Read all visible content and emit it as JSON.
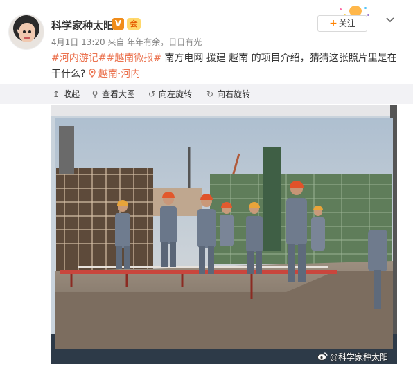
{
  "user": {
    "name": "科学家种太阳",
    "verified_badge": "V",
    "vip_badge": "会"
  },
  "post": {
    "meta": "4月1日 13:20 来自 年年有余，日日有光",
    "hashtag1": "#河内游记#",
    "hashtag2": "#越南微报#",
    "text": " 南方电网 援建 越南 的项目介绍，猜猜这张照片里是在干什么?",
    "location": "越南·河内"
  },
  "header": {
    "follow_label": "关注",
    "follow_plus": "+"
  },
  "toolbar": {
    "collapse": "收起",
    "view_large": "查看大图",
    "rotate_left": "向左旋转",
    "rotate_right": "向右旋转"
  },
  "photo": {
    "watermark": "@科学家种太阳"
  },
  "colors": {
    "accent": "#eb7350",
    "follow_plus": "#ff8200",
    "verified": "#f08c1a",
    "toolbar_bg": "#f2f2f5"
  },
  "icons": [
    "collapse-icon",
    "zoom-icon",
    "rotate-left-icon",
    "rotate-right-icon",
    "location-pin-icon",
    "chevron-down-icon",
    "weibo-logo-icon"
  ]
}
